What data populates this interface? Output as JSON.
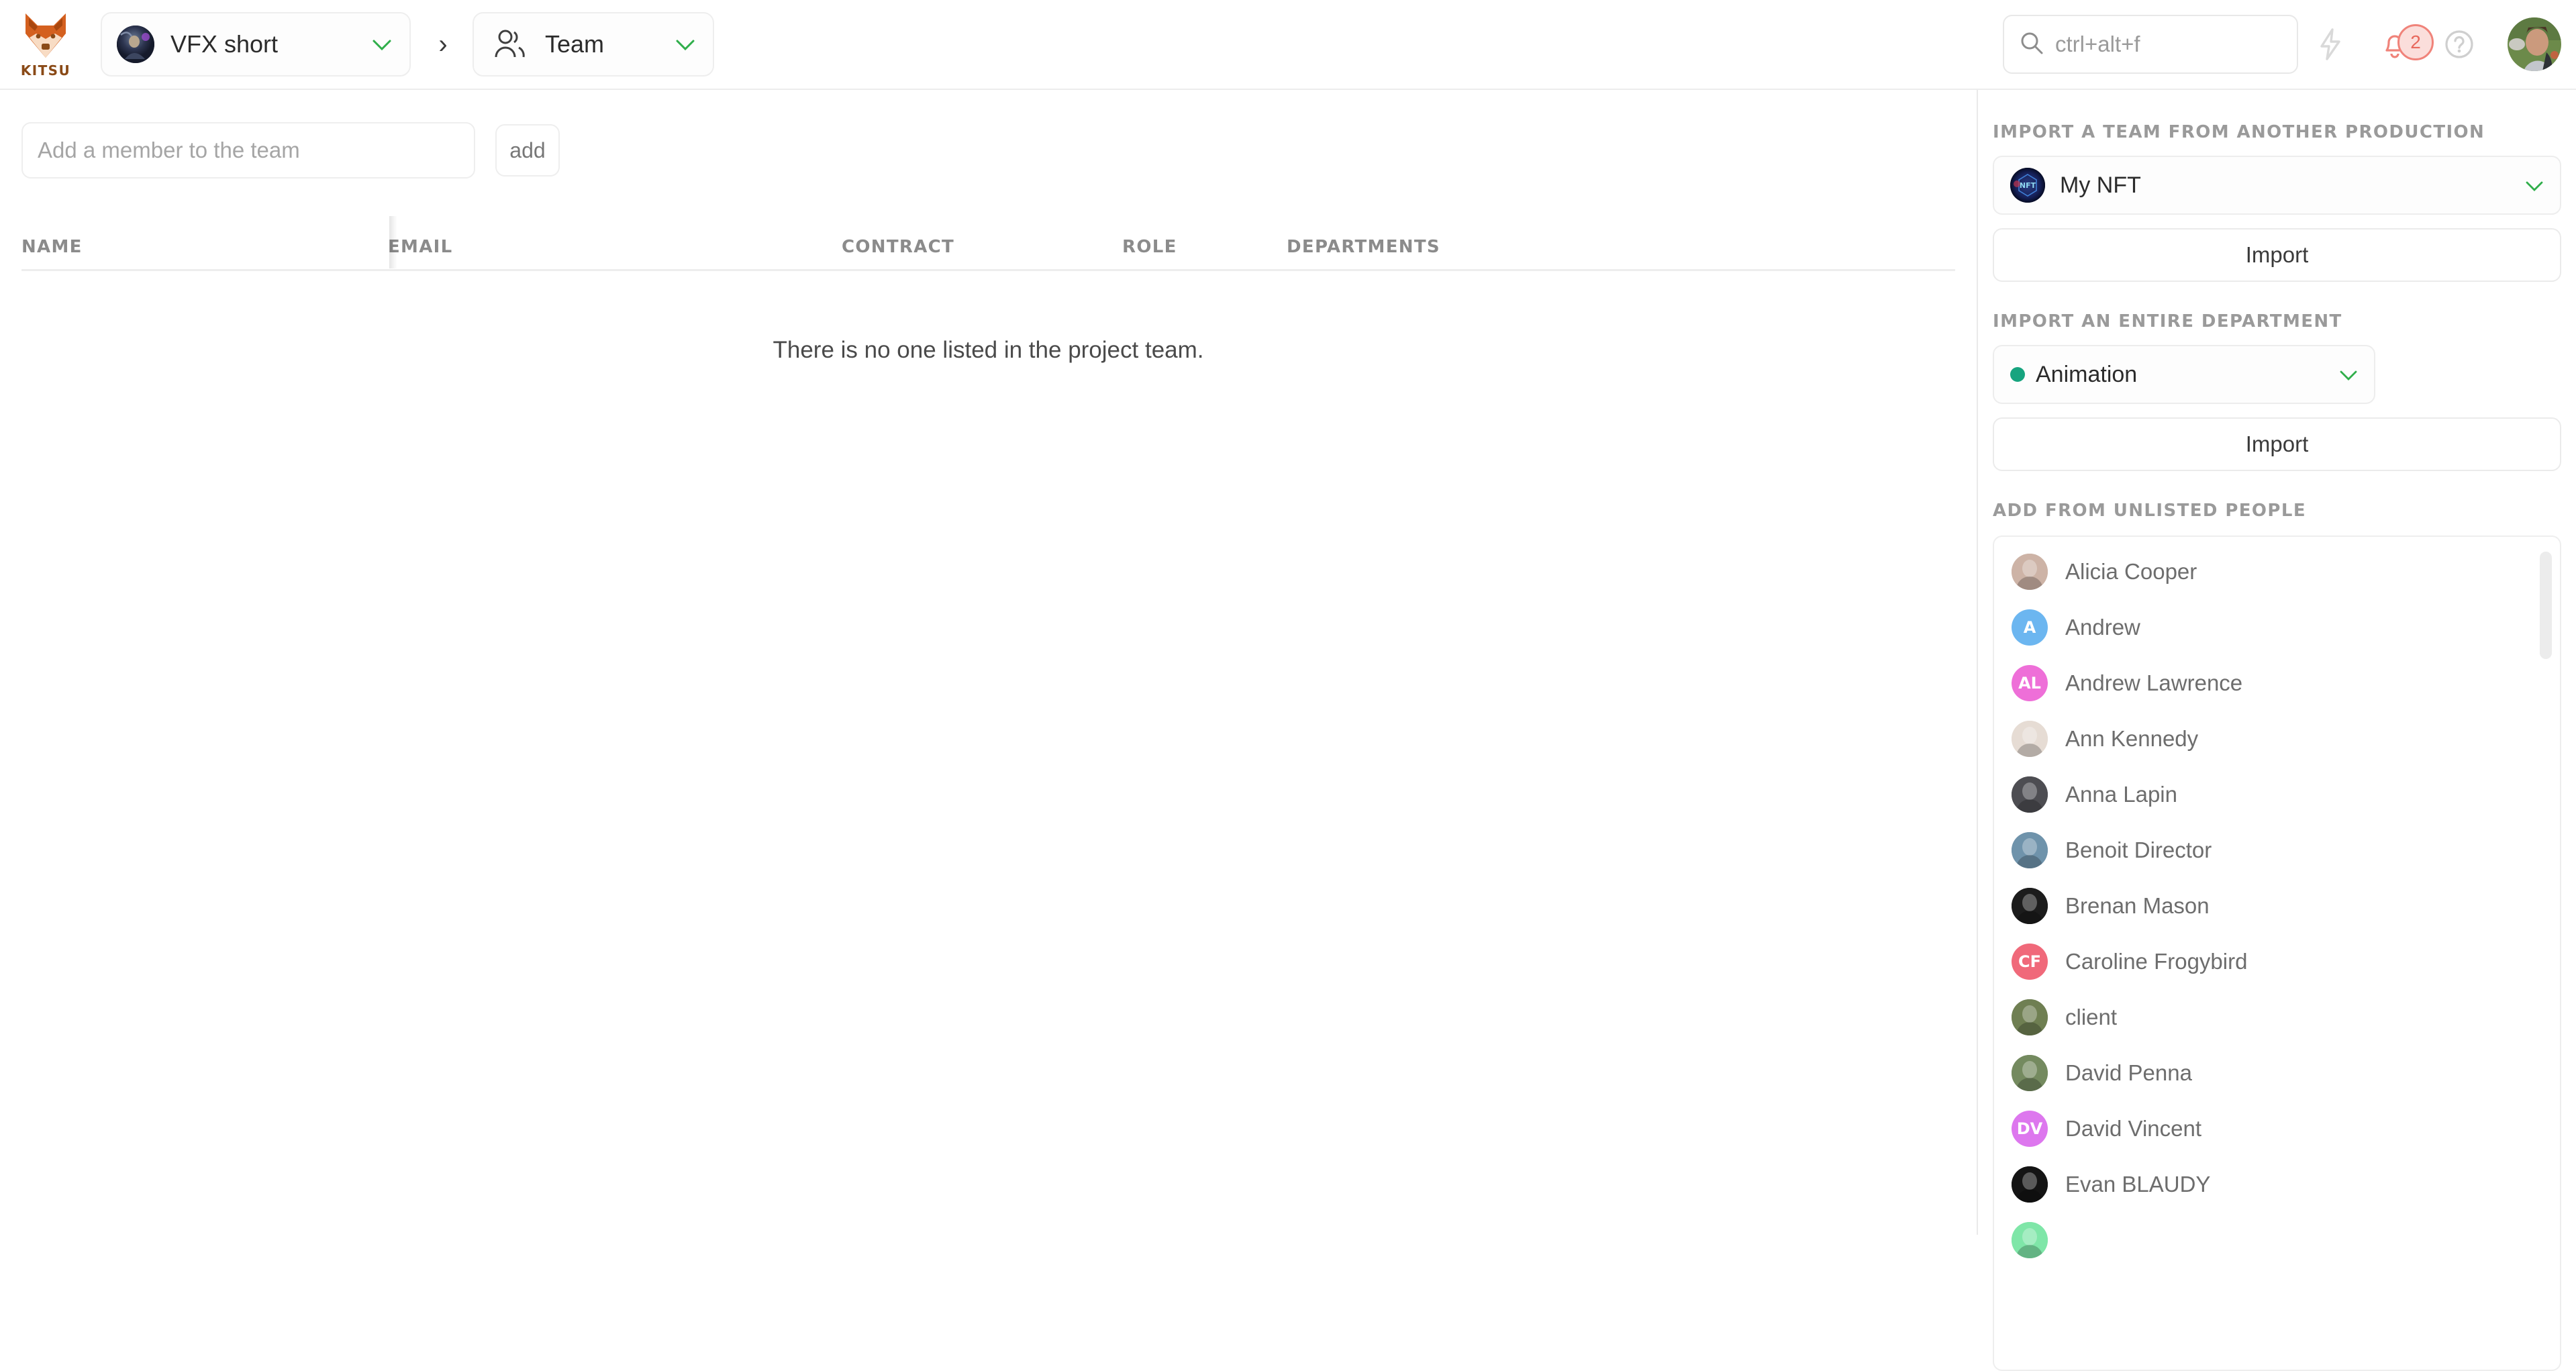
{
  "app": {
    "logo_word": "KITSU",
    "logo_icon": "fox-head-icon"
  },
  "breadcrumb": {
    "project": {
      "label": "VFX short",
      "caret": "⌄",
      "avatar": "project-avatar"
    },
    "separator": "›",
    "section": {
      "label": "Team",
      "caret": "⌄",
      "icon": "users-icon"
    }
  },
  "search": {
    "placeholder": "ctrl+alt+f",
    "icon": "search-icon"
  },
  "topbar_actions": {
    "bolt_icon": "lightning-bolt-icon",
    "bell_icon": "notification-bell-icon",
    "bell_count": "2",
    "help_icon": "help-circle-icon",
    "avatar": "user-avatar"
  },
  "main": {
    "add_member": {
      "placeholder": "Add a member to the team",
      "value": "",
      "button_label": "add"
    },
    "table": {
      "columns": [
        "NAME",
        "EMAIL",
        "CONTRACT",
        "ROLE",
        "DEPARTMENTS"
      ],
      "rows": [],
      "empty_message": "There is no one listed in the project team."
    }
  },
  "sidebar": {
    "import_team": {
      "title": "IMPORT A TEAM FROM ANOTHER PRODUCTION",
      "selected": "My NFT",
      "avatar_label": "NFT",
      "caret": "⌄",
      "button_label": "Import"
    },
    "import_department": {
      "title": "IMPORT AN ENTIRE DEPARTMENT",
      "selected": "Animation",
      "dot_color": "#17a47f",
      "caret": "⌄",
      "button_label": "Import"
    },
    "unlisted": {
      "title": "ADD FROM UNLISTED PEOPLE",
      "people": [
        {
          "name": "Alicia Cooper",
          "kind": "photo",
          "tone": "#cdb3a6"
        },
        {
          "name": "Andrew",
          "kind": "initials",
          "initials": "A",
          "color": "#6cb6f0"
        },
        {
          "name": "Andrew Lawrence",
          "kind": "initials",
          "initials": "AL",
          "color": "#ee6fd8"
        },
        {
          "name": "Ann Kennedy",
          "kind": "photo",
          "tone": "#e6dcd4"
        },
        {
          "name": "Anna Lapin",
          "kind": "photo",
          "tone": "#4d4d52"
        },
        {
          "name": "Benoit Director",
          "kind": "photo",
          "tone": "#6f93ab"
        },
        {
          "name": "Brenan Mason",
          "kind": "photo",
          "tone": "#1c1c1c"
        },
        {
          "name": "Caroline Frogybird",
          "kind": "initials",
          "initials": "CF",
          "color": "#f0697a"
        },
        {
          "name": "client",
          "kind": "photo",
          "tone": "#6f7f52"
        },
        {
          "name": "David Penna",
          "kind": "photo",
          "tone": "#748a5f"
        },
        {
          "name": "David Vincent",
          "kind": "initials",
          "initials": "DV",
          "color": "#dd77ee"
        },
        {
          "name": "Evan BLAUDY",
          "kind": "photo",
          "tone": "#141414"
        },
        {
          "name": "",
          "kind": "photo",
          "tone": "#7fe6a8"
        }
      ]
    }
  },
  "colors": {
    "accent_green": "#2fae4a",
    "brand_orange": "#d4601f",
    "notification_red": "#e8685c",
    "text_muted": "#9a9a9a"
  }
}
